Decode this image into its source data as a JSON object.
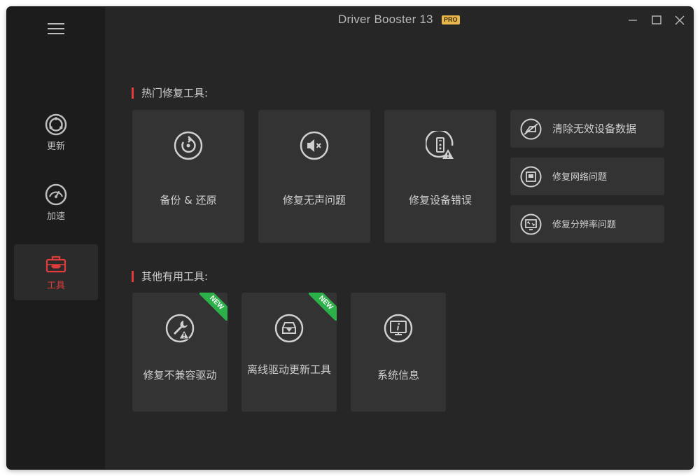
{
  "window": {
    "title": "Driver Booster 13",
    "badge": "PRO"
  },
  "colors": {
    "accent": "#e23b3b",
    "background": "#262626",
    "sidebar": "#1c1c1c",
    "card": "#333333",
    "badge": "#e8b64a",
    "new_ribbon": "#2cb04a"
  },
  "sidebar": {
    "menu_icon": "hamburger-menu-icon",
    "items": [
      {
        "label": "更新",
        "icon": "update-refresh-icon",
        "active": false
      },
      {
        "label": "加速",
        "icon": "speedometer-icon",
        "active": false
      },
      {
        "label": "工具",
        "icon": "toolbox-icon",
        "active": true
      }
    ]
  },
  "hot_tools": {
    "title": "热门修复工具:",
    "cards": [
      {
        "label": "备份 & 还原",
        "icon": "backup-restore-icon"
      },
      {
        "label": "修复无声问题",
        "icon": "speaker-muted-icon"
      },
      {
        "label": "修复设备错误",
        "icon": "device-warning-icon"
      }
    ],
    "side_items": [
      {
        "label": "清除无效设备数据",
        "icon": "clear-device-data-icon"
      },
      {
        "label": "修复网络问题",
        "icon": "network-port-icon"
      },
      {
        "label": "修复分辨率问题",
        "icon": "monitor-resolution-icon"
      }
    ]
  },
  "other_tools": {
    "title": "其他有用工具:",
    "cards": [
      {
        "label": "修复不兼容驱动",
        "icon": "wrench-warning-icon",
        "badge": "NEW"
      },
      {
        "label": "离线驱动更新工具",
        "icon": "offline-download-icon",
        "badge": "NEW"
      },
      {
        "label": "系统信息",
        "icon": "monitor-info-icon",
        "badge": ""
      }
    ]
  }
}
